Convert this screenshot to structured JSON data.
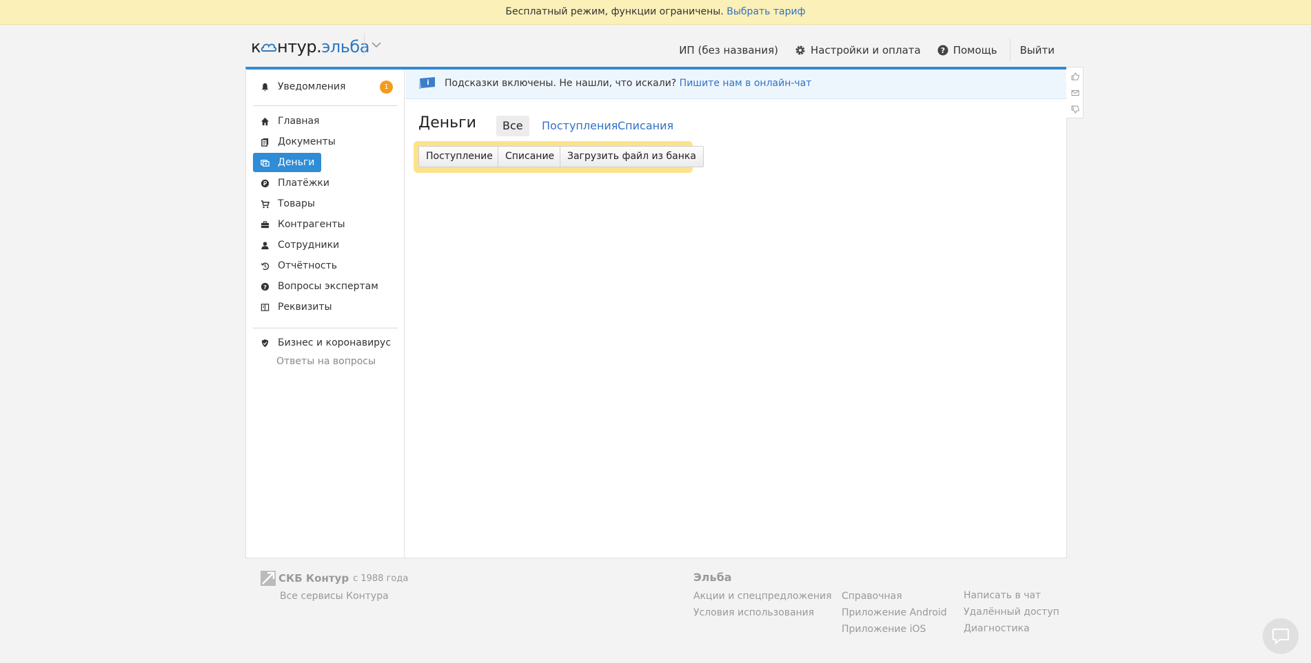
{
  "banner": {
    "text": "Бесплатный режим, функции ограничены.",
    "link": "Выбрать тариф"
  },
  "header": {
    "logo_part1": "к",
    "logo_part2": "нтур.",
    "logo_part3": "эльба",
    "org": "ИП (без названия)",
    "settings": "Настройки и оплата",
    "help": "Помощь",
    "logout": "Выйти"
  },
  "sidebar": {
    "notifications": "Уведомления",
    "notifications_count": "1",
    "items": [
      {
        "label": "Главная",
        "icon": "home-icon"
      },
      {
        "label": "Документы",
        "icon": "documents-icon"
      },
      {
        "label": "Деньги",
        "icon": "money-icon"
      },
      {
        "label": "Платёжки",
        "icon": "payments-icon"
      },
      {
        "label": "Товары",
        "icon": "cart-icon"
      },
      {
        "label": "Контрагенты",
        "icon": "briefcase-icon"
      },
      {
        "label": "Сотрудники",
        "icon": "user-icon"
      },
      {
        "label": "Отчётность",
        "icon": "reports-icon"
      },
      {
        "label": "Вопросы экспертам",
        "icon": "question-icon"
      },
      {
        "label": "Реквизиты",
        "icon": "requisites-icon"
      }
    ],
    "covid_title": "Бизнес и коронавирус",
    "covid_sub": "Ответы на вопросы"
  },
  "tips": {
    "text": "Подсказки включены. Не нашли, что искали?",
    "link": "Пишите нам в онлайн-чат"
  },
  "main": {
    "title": "Деньги",
    "tabs": [
      "Все",
      "Поступления",
      "Списания"
    ],
    "buttons": [
      "Поступление",
      "Списание",
      "Загрузить файл из банка"
    ]
  },
  "footer": {
    "brand": "СКБ Контур",
    "since": "с 1988 года",
    "all_services": "Все сервисы Контура",
    "elba_head": "Эльба",
    "col1": [
      "Акции и спецпредложения",
      "Условия использования"
    ],
    "col2": [
      "Справочная",
      "Приложение Android",
      "Приложение iOS"
    ],
    "col3": [
      "Написать в чат",
      "Удалённый доступ",
      "Диагностика"
    ]
  },
  "colors": {
    "accent": "#2f8cd6",
    "banner_bg": "#fbf0b8",
    "badge": "#f39c1c",
    "highlight": "#fce38a"
  }
}
